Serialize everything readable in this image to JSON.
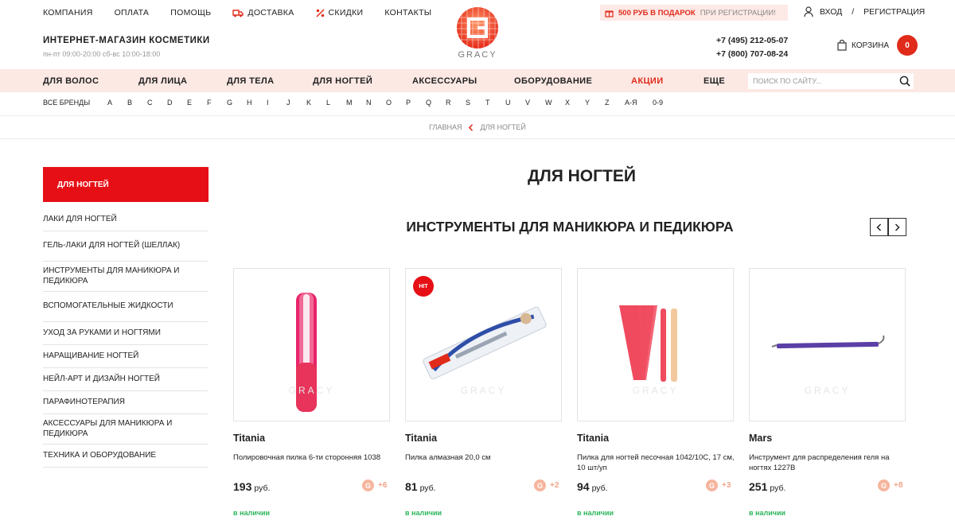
{
  "top_nav": [
    {
      "label": "КОМПАНИЯ"
    },
    {
      "label": "ОПЛАТА"
    },
    {
      "label": "ПОМОЩЬ"
    },
    {
      "label": "ДОСТАВКА",
      "icon": "truck-icon"
    },
    {
      "label": "СКИДКИ",
      "icon": "percent-icon"
    },
    {
      "label": "КОНТАКТЫ"
    }
  ],
  "promo": {
    "highlight": "500 РУБ В ПОДАРОК",
    "text": "ПРИ РЕГИСТРАЦИИ!"
  },
  "auth": {
    "login": "ВХОД",
    "separator": "/",
    "register": "РЕГИСТРАЦИЯ"
  },
  "shop": {
    "name": "ИНТЕРНЕТ-МАГАЗИН КОСМЕТИКИ",
    "hours": "пн-пт 09:00-20:00 сб-вс 10:00-18:00"
  },
  "logo": {
    "text": "GRACY"
  },
  "phones": [
    "+7 (495) 212-05-07",
    "+7 (800) 707-08-24"
  ],
  "cart": {
    "label": "КОРЗИНА",
    "count": "0"
  },
  "main_nav": [
    {
      "label": "ДЛЯ ВОЛОС"
    },
    {
      "label": "ДЛЯ ЛИЦА"
    },
    {
      "label": "ДЛЯ ТЕЛА"
    },
    {
      "label": "ДЛЯ НОГТЕЙ"
    },
    {
      "label": "АКСЕССУАРЫ"
    },
    {
      "label": "ОБОРУДОВАНИЕ"
    },
    {
      "label": "АКЦИИ",
      "accent": "#e02b1b"
    },
    {
      "label": "ЕЩЕ"
    }
  ],
  "search": {
    "placeholder": "ПОИСК ПО САЙТУ..."
  },
  "brands": [
    "ВСЕ БРЕНДЫ",
    "A",
    "B",
    "C",
    "D",
    "E",
    "F",
    "G",
    "H",
    "I",
    "J",
    "K",
    "L",
    "M",
    "N",
    "O",
    "P",
    "Q",
    "R",
    "S",
    "T",
    "U",
    "V",
    "W",
    "X",
    "Y",
    "Z",
    "А-Я",
    "0-9"
  ],
  "breadcrumb": {
    "home": "ГЛАВНАЯ",
    "current": "ДЛЯ НОГТЕЙ"
  },
  "sidebar": {
    "title": "ДЛЯ НОГТЕЙ",
    "items": [
      {
        "label": "ЛАКИ ДЛЯ НОГТЕЙ"
      },
      {
        "label": "ГЕЛЬ-ЛАКИ ДЛЯ НОГТЕЙ (ШЕЛЛАК)"
      },
      {
        "label": "ИНСТРУМЕНТЫ ДЛЯ МАНИКЮРА И ПЕДИКЮРА"
      },
      {
        "label": "ВСПОМОГАТЕЛЬНЫЕ ЖИДКОСТИ"
      },
      {
        "label": "УХОД ЗА РУКАМИ И НОГТЯМИ"
      },
      {
        "label": "НАРАЩИВАНИЕ НОГТЕЙ"
      },
      {
        "label": "НЕЙЛ-АРТ И ДИЗАЙН НОГТЕЙ"
      },
      {
        "label": "ПАРАФИНОТЕРАПИЯ"
      },
      {
        "label": "АКСЕССУАРЫ ДЛЯ МАНИКЮРА И ПЕДИКЮРА"
      },
      {
        "label": "ТЕХНИКА И ОБОРУДОВАНИЕ"
      }
    ]
  },
  "page_title": "ДЛЯ НОГТЕЙ",
  "section_title": "ИНСТРУМЕНТЫ ДЛЯ МАНИКЮРА И ПЕДИКЮРА",
  "watermark": "GRACY",
  "products": [
    {
      "brand": "Titania",
      "name": "Полировочная пилка 6-ти сторонняя 1038",
      "price": "193",
      "currency": "руб.",
      "bonus": "+6",
      "stock": "в наличии",
      "badge": "",
      "image": "buffer-file-image"
    },
    {
      "brand": "Titania",
      "name": "Пилка алмазная 20,0 см",
      "price": "81",
      "currency": "руб.",
      "bonus": "+2",
      "stock": "в наличии",
      "badge": "HIT",
      "image": "diamond-file-image"
    },
    {
      "brand": "Titania",
      "name": "Пилка для ногтей песочная 1042/10С, 17 см, 10 шт/уп",
      "price": "94",
      "currency": "руб.",
      "bonus": "+3",
      "stock": "в наличии",
      "badge": "",
      "image": "emery-boards-image"
    },
    {
      "brand": "Mars",
      "name": "Инструмент для распределения геля на ногтях 1227В",
      "price": "251",
      "currency": "руб.",
      "bonus": "+8",
      "stock": "в наличии",
      "badge": "",
      "image": "gel-tool-image"
    }
  ],
  "colors": {
    "accent": "#e60f16",
    "band": "#fce9e4",
    "stock": "#2bb55a",
    "bonus": "#f6b59d"
  }
}
